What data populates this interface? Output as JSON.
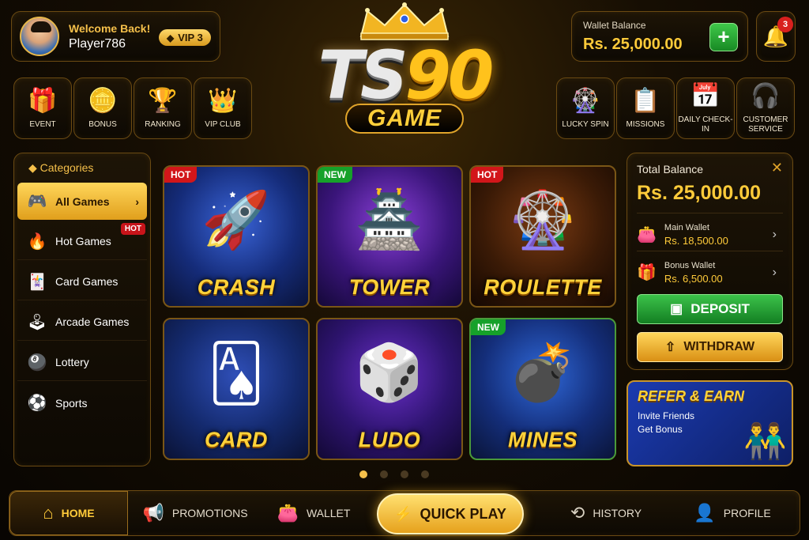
{
  "header": {
    "welcome": "Welcome Back!",
    "username": "Player786",
    "vip": "VIP 3",
    "logo_main_a": "TS",
    "logo_main_b": "90",
    "logo_sub": "GAME",
    "wallet_label": "Wallet Balance",
    "wallet_value": "Rs. 25,000.00",
    "notifications": "3"
  },
  "left_quick": [
    {
      "label": "EVENT",
      "icon": "gift-icon"
    },
    {
      "label": "BONUS",
      "icon": "coin-icon"
    },
    {
      "label": "RANKING",
      "icon": "trophy-icon"
    },
    {
      "label": "VIP CLUB",
      "icon": "crown-icon"
    }
  ],
  "right_quick": [
    {
      "label": "LUCKY SPIN",
      "icon": "wheel-icon"
    },
    {
      "label": "MISSIONS",
      "icon": "clipboard-icon"
    },
    {
      "label": "DAILY CHECK-IN",
      "icon": "calendar-icon"
    },
    {
      "label": "CUSTOMER SERVICE",
      "icon": "headset-icon"
    }
  ],
  "categories": {
    "title": "Categories",
    "items": [
      {
        "label": "All Games",
        "icon": "gamepad-icon"
      },
      {
        "label": "Hot Games",
        "icon": "fire-icon",
        "badge": "HOT"
      },
      {
        "label": "Card Games",
        "icon": "cards-icon"
      },
      {
        "label": "Arcade Games",
        "icon": "joystick-icon"
      },
      {
        "label": "Lottery",
        "icon": "lottery-ball-icon"
      },
      {
        "label": "Sports",
        "icon": "football-icon"
      }
    ]
  },
  "games": [
    {
      "name": "CRASH",
      "tag": "HOT"
    },
    {
      "name": "TOWER",
      "tag": "NEW"
    },
    {
      "name": "ROULETTE",
      "tag": "HOT"
    },
    {
      "name": "CARD",
      "tag": ""
    },
    {
      "name": "LUDO",
      "tag": ""
    },
    {
      "name": "MINES",
      "tag": "NEW"
    }
  ],
  "balance": {
    "title": "Total Balance",
    "value": "Rs. 25,000.00",
    "main_label": "Main Wallet",
    "main_value": "Rs. 18,500.00",
    "bonus_label": "Bonus Wallet",
    "bonus_value": "Rs. 6,500.00",
    "deposit": "DEPOSIT",
    "withdraw": "WITHDRAW"
  },
  "refer": {
    "title": "REFER & EARN",
    "line1": "Invite Friends",
    "line2": "Get Bonus"
  },
  "nav": {
    "home": "HOME",
    "promotions": "PROMOTIONS",
    "wallet": "WALLET",
    "quick_play": "QUICK PLAY",
    "history": "HISTORY",
    "profile": "PROFILE"
  },
  "colors": {
    "accent_gold": "#f5c04a",
    "hot_red": "#d2161a",
    "new_green": "#16a12a",
    "deposit_green": "#3cc24a"
  }
}
